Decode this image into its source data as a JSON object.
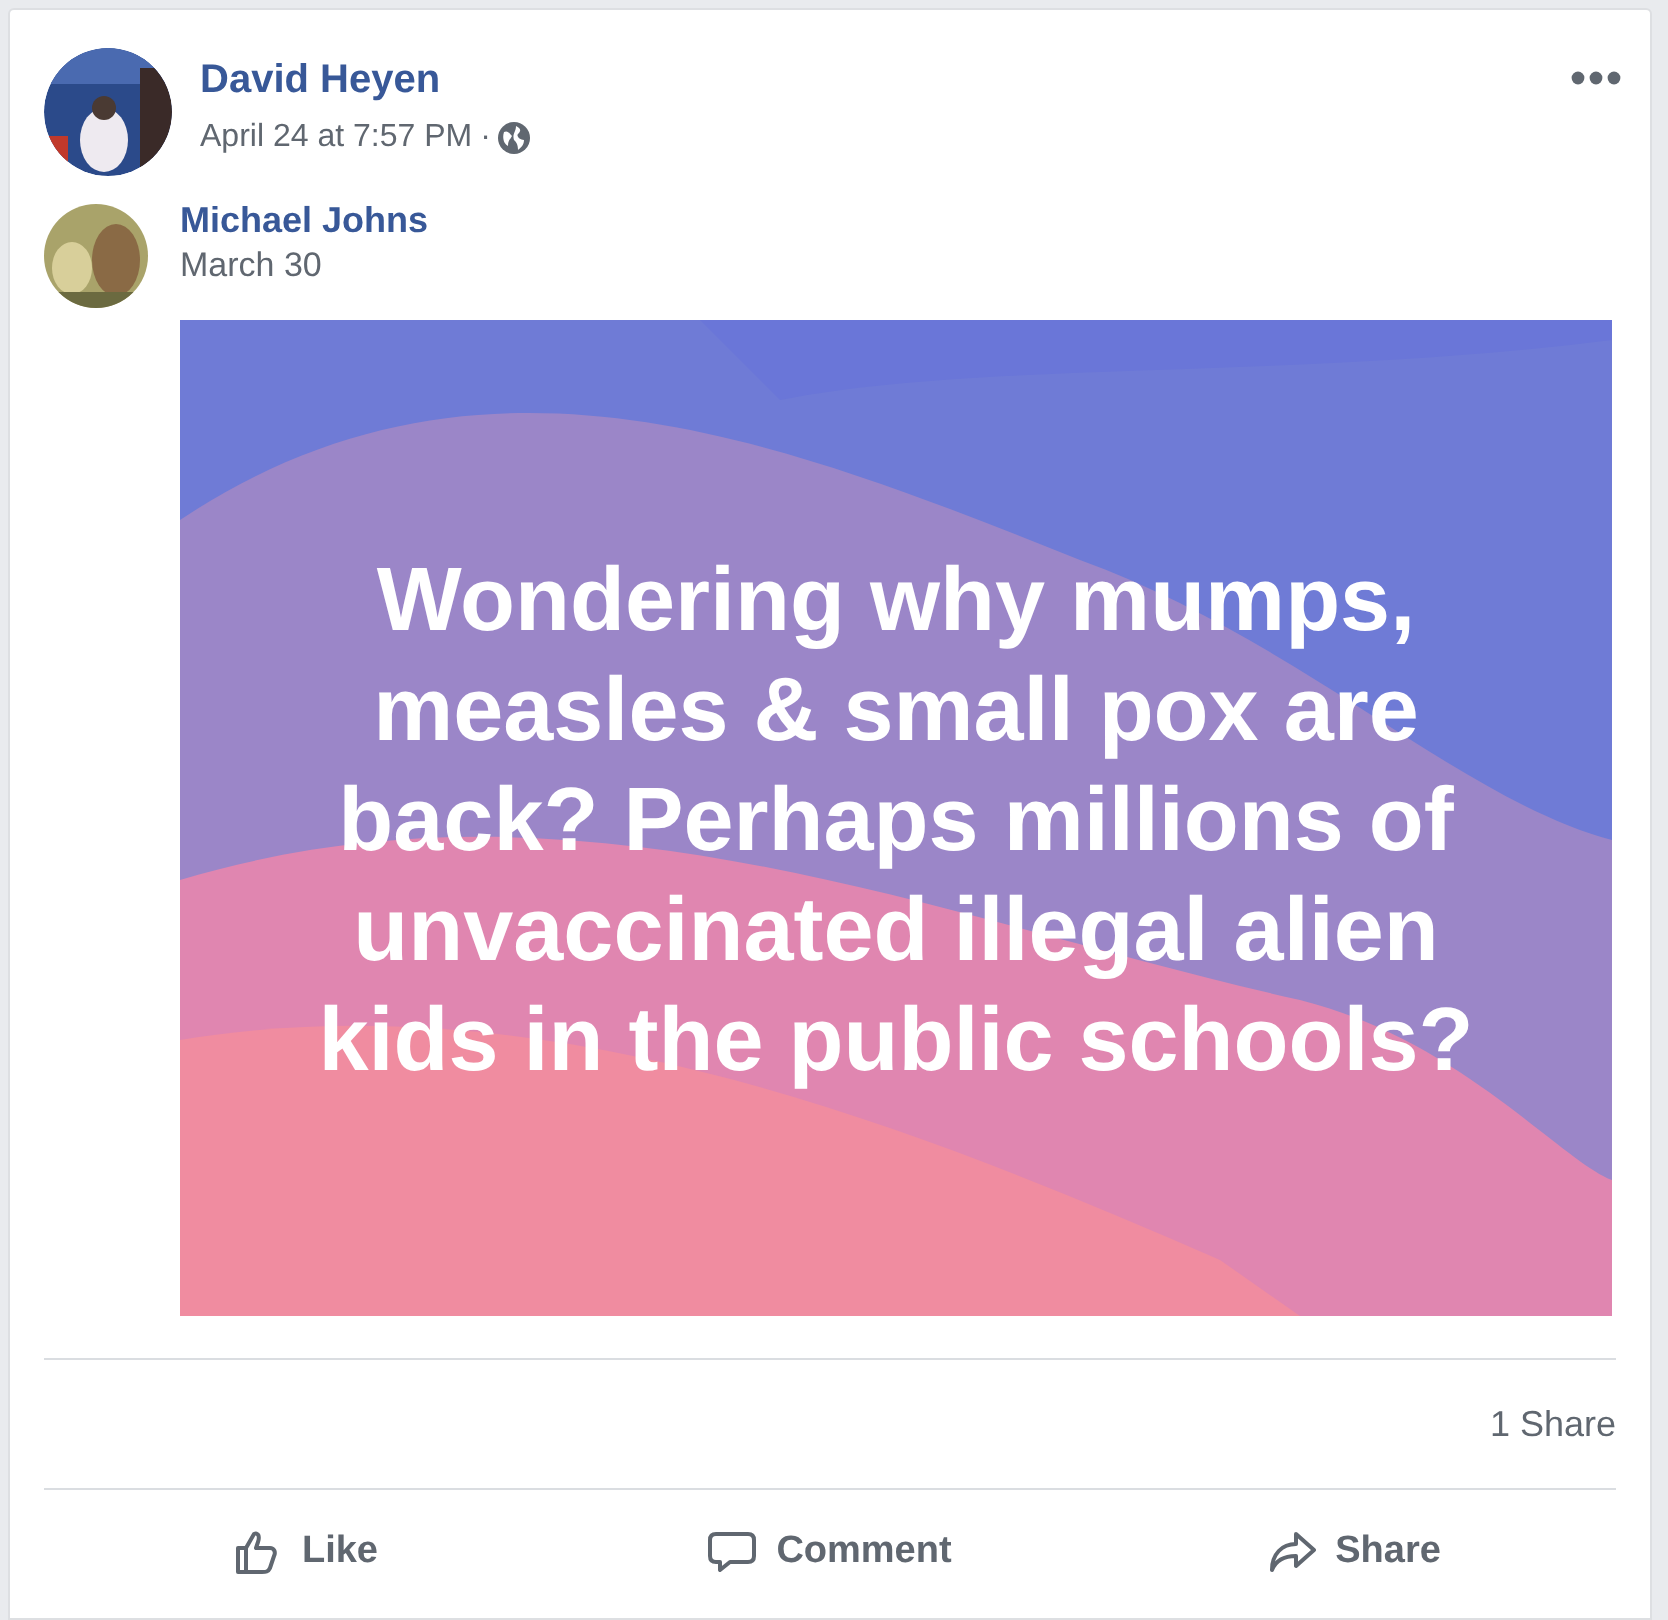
{
  "post": {
    "author": "David Heyen",
    "timestamp": "April 24 at 7:57 PM",
    "separator": "·"
  },
  "shared_post": {
    "author": "Michael Johns",
    "date": "March 30",
    "text": "Wondering why mumps, measles & small pox are back? Perhaps millions of unvaccinated illegal alien kids in the public schools?"
  },
  "stats": {
    "shares": "1 Share"
  },
  "actions": [
    {
      "kind": "like",
      "label": "Like"
    },
    {
      "kind": "comment",
      "label": "Comment"
    },
    {
      "kind": "share",
      "label": "Share"
    }
  ]
}
